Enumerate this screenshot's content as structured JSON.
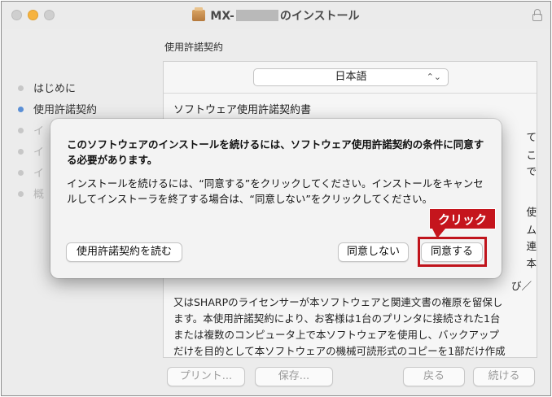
{
  "window": {
    "title_prefix": "MX-",
    "title_suffix": "のインストール"
  },
  "sidebar": {
    "steps": [
      {
        "label": "はじめに"
      },
      {
        "label": "使用許諾契約"
      },
      {
        "label": "イ"
      },
      {
        "label": "イ"
      },
      {
        "label": "イ"
      },
      {
        "label": "概"
      }
    ]
  },
  "main": {
    "section_label": "使用許諾契約",
    "language_select": "日本語",
    "doc_title": "ソフトウェア使用許諾契約書",
    "peek_right": [
      "て",
      "こ",
      "で",
      "使",
      "ム",
      "連",
      "本"
    ],
    "license_lines": [
      "び／",
      "又はSHARPのライセンサーが本ソフトウェアと関連文書の権原を留保し",
      "ます。本使用許諾契約により、お客様は1台のプリンタに接続された1台",
      "または複数のコンピュータ上で本ソフトウェアを使用し、バックアップ",
      "だけを目的として本ソフトウェアの機械可読形式のコピーを1部だけ作成"
    ]
  },
  "bottom": {
    "print_label": "プリント...",
    "save_label": "保存...",
    "back_label": "戻る",
    "continue_label": "続ける"
  },
  "dialog": {
    "heading": "このソフトウェアのインストールを続けるには、ソフトウェア使用許諾契約の条件に同意する必要があります。",
    "body": "インストールを続けるには、“同意する”をクリックしてください。インストールをキャンセルしてインストーラを終了する場合は、“同意しない”をクリックしてください。",
    "read_license_label": "使用許諾契約を読む",
    "disagree_label": "同意しない",
    "agree_label": "同意する"
  },
  "annotation": {
    "callout_label": "クリック",
    "highlight_color": "#c0141c"
  }
}
